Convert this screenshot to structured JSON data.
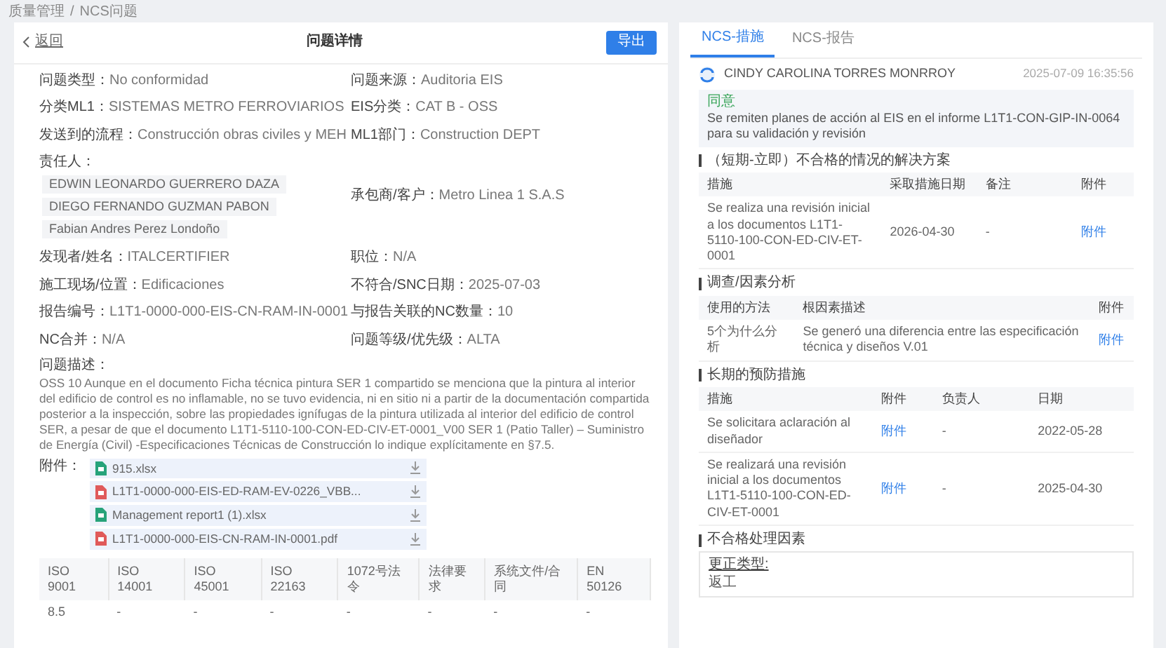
{
  "breadcrumb": {
    "items": [
      "质量管理",
      "NCS问题"
    ],
    "separator": "/"
  },
  "header": {
    "back": "返回",
    "title": "问题详情",
    "export_button": "导出"
  },
  "fields": [
    {
      "kind": "text",
      "label": "问题类型：",
      "value": "No conformidad"
    },
    {
      "kind": "text",
      "label": "问题来源：",
      "value": "Auditoria EIS"
    },
    {
      "kind": "text",
      "label": "分类ML1：",
      "value": "SISTEMAS METRO FERROVIARIOS"
    },
    {
      "kind": "text",
      "label": "EIS分类：",
      "value": "CAT B - OSS"
    },
    {
      "kind": "text",
      "label": "发送到的流程：",
      "value": "Construcción obras civiles y MEH"
    },
    {
      "kind": "text",
      "label": "ML1部门：",
      "value": "Construction DEPT"
    },
    {
      "kind": "list",
      "label": "责任人：",
      "values": [
        "EDWIN LEONARDO GUERRERO DAZA",
        "DIEGO FERNANDO GUZMAN PABON",
        "Fabian Andres Perez Londoño"
      ]
    },
    {
      "kind": "text",
      "label": "承包商/客户：",
      "value": "Metro Linea 1 S.A.S"
    },
    {
      "kind": "text",
      "label": "发现者/姓名：",
      "value": "ITALCERTIFIER"
    },
    {
      "kind": "text",
      "label": "职位：",
      "value": "N/A"
    },
    {
      "kind": "text",
      "label": "施工现场/位置：",
      "value": "Edificaciones"
    },
    {
      "kind": "text",
      "label": "不符合/SNC日期：",
      "value": "2025-07-03"
    },
    {
      "kind": "text",
      "label": "报告编号：",
      "value": "L1T1-0000-000-EIS-CN-RAM-IN-0001"
    },
    {
      "kind": "text",
      "label": "与报告关联的NC数量：",
      "value": "10"
    },
    {
      "kind": "text",
      "label": "NC合并：",
      "value": "N/A"
    },
    {
      "kind": "text",
      "label": "问题等级/优先级：",
      "value": "ALTA"
    }
  ],
  "description": {
    "label": "问题描述：",
    "text": "OSS 10 Aunque en el documento Ficha técnica pintura SER 1 compartido se menciona que la pintura al interior del edificio de control es no inflamable, no se tuvo evidencia, ni en sitio ni a partir de la documentación compartida posterior a la inspección, sobre las propiedades ignífugas de la pintura utilizada al interior del edificio de control SER, a pesar de que el documento L1T1-5110-100-CON-ED-CIV-ET-0001_V00 SER 1 (Patio Taller) – Suministro de Energía (Civil) -Especificaciones Técnicas de Construcción lo indique explícitamente en §7.5."
  },
  "attachments": {
    "label": "附件：",
    "files": [
      {
        "kind": "excel",
        "name": "915.xlsx"
      },
      {
        "kind": "pdf",
        "name": "L1T1-0000-000-EIS-ED-RAM-EV-0226_VBB..."
      },
      {
        "kind": "excel",
        "name": "Management report1 (1).xlsx"
      },
      {
        "kind": "pdf",
        "name": "L1T1-0000-000-EIS-CN-RAM-IN-0001.pdf"
      }
    ]
  },
  "standards_table": {
    "columns": [
      "ISO 9001",
      "ISO 14001",
      "ISO 45001",
      "ISO 22163",
      "1072号法令",
      "法律要求",
      "系统文件/合同",
      "EN 50126"
    ],
    "rows": [
      [
        "8.5",
        "-",
        "-",
        "-",
        "-",
        "-",
        "-",
        "-"
      ]
    ]
  },
  "tabs": [
    {
      "label": "NCS-措施",
      "selected": true
    },
    {
      "label": "NCS-报告",
      "selected": false
    }
  ],
  "comment": {
    "author": "CINDY CAROLINA TORRES MONRROY",
    "time": "2025-07-09 16:35:56",
    "status": "同意",
    "text": "Se remiten planes de acción al EIS en el informe L1T1-CON-GIP-IN-0064 para su validación y revisión"
  },
  "sections": [
    {
      "kind": "table",
      "title": "（短期-立即）不合格的情况的解决方案",
      "columns": [
        {
          "label": "措施",
          "kind": "text"
        },
        {
          "label": "采取措施日期",
          "kind": "text"
        },
        {
          "label": "备注",
          "kind": "text"
        },
        {
          "label": "附件",
          "kind": "link"
        }
      ],
      "rows": [
        [
          "Se realiza una revisión inicial a los documentos L1T1-5110-100-CON-ED-CIV-ET-0001",
          "2026-04-30",
          "-",
          "附件"
        ]
      ]
    },
    {
      "kind": "table",
      "title": "调查/因素分析",
      "columns": [
        {
          "label": "使用的方法",
          "kind": "text"
        },
        {
          "label": "根因素描述",
          "kind": "text"
        },
        {
          "label": "附件",
          "kind": "link"
        }
      ],
      "rows": [
        [
          "5个为什么分析",
          "Se generó una diferencia entre las especificación técnica y diseños V.01",
          "附件"
        ]
      ]
    },
    {
      "kind": "table",
      "title": "长期的预防措施",
      "columns": [
        {
          "label": "措施",
          "kind": "text"
        },
        {
          "label": "附件",
          "kind": "link"
        },
        {
          "label": "负责人",
          "kind": "text"
        },
        {
          "label": "日期",
          "kind": "text"
        }
      ],
      "rows": [
        [
          "Se solicitara aclaración al diseñador",
          "附件",
          "-",
          "2022-05-28"
        ],
        [
          "Se realizará una revisión inicial a los documentos L1T1-5110-100-CON-ED-CIV-ET-0001",
          "附件",
          "-",
          "2025-04-30"
        ]
      ]
    },
    {
      "kind": "box",
      "title": "不合格处理因素",
      "label": "更正类型:",
      "value": "返工"
    }
  ]
}
